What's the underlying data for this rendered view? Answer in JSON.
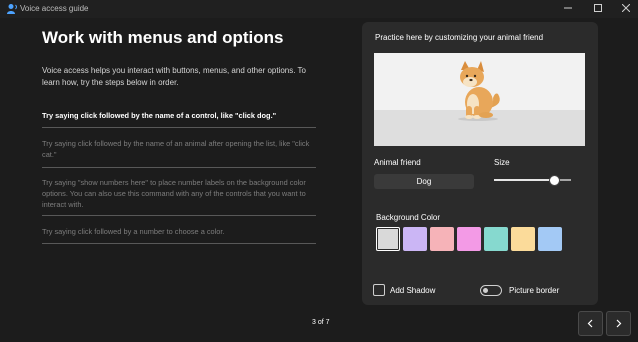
{
  "window": {
    "title": "Voice access guide",
    "app_icon": "person-voice-icon",
    "controls": [
      "minimize-icon",
      "maximize-icon",
      "close-icon"
    ]
  },
  "left": {
    "heading": "Work with menus and options",
    "intro": "Voice access helps you interact with buttons, menus, and other options. To learn how, try the steps below in order.",
    "steps": [
      {
        "text": "Try saying click followed by the name of a control, like \"click dog.\"",
        "active": true
      },
      {
        "text": "Try saying click followed by the name of an animal after opening the list, like \"click cat.\"",
        "active": false
      },
      {
        "text": "Try saying \"show numbers here\" to place number labels on the background color options. You can also use this command with any of the controls that you want to interact with.",
        "active": false
      },
      {
        "text": "Try saying click followed by a number to choose a color.",
        "active": false
      }
    ]
  },
  "panel": {
    "title": "Practice here by customizing your animal friend",
    "preview_image": "shiba-dog-illustration",
    "animal_label": "Animal friend",
    "animal_value": "Dog",
    "size_label": "Size",
    "size_value": 0.78,
    "bg_label": "Background Color",
    "swatches": [
      "#d9d9d9",
      "#cbb6f5",
      "#f6b3b8",
      "#f39ae6",
      "#86d9cf",
      "#fbdb9a",
      "#a3c9f5"
    ],
    "selected_swatch": 0,
    "shadow_label": "Add Shadow",
    "shadow_checked": false,
    "border_label": "Picture border",
    "border_on": false
  },
  "footer": {
    "page": "3 of 7",
    "prev_icon": "chevron-left-icon",
    "next_icon": "chevron-right-icon"
  }
}
